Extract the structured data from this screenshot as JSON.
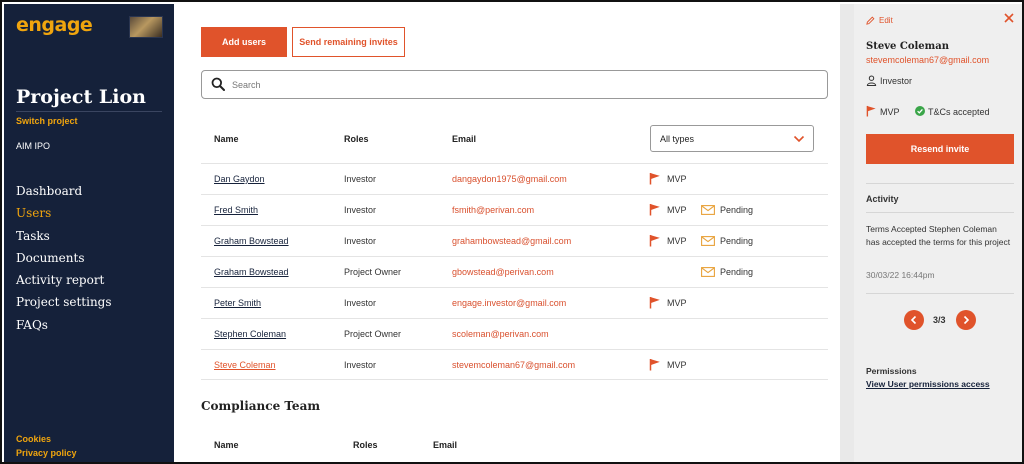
{
  "sidebar": {
    "logo": "engage",
    "project_title": "Project Lion",
    "switch_project": "Switch project",
    "subproject": "AIM IPO",
    "nav": [
      "Dashboard",
      "Users",
      "Tasks",
      "Documents",
      "Activity report",
      "Project settings",
      "FAQs"
    ],
    "active_nav": "Users",
    "cookies": "Cookies",
    "privacy": "Privacy policy"
  },
  "toolbar": {
    "add_users": "Add users",
    "send_invites": "Send remaining invites"
  },
  "search": {
    "placeholder": "Search"
  },
  "table": {
    "headers": {
      "name": "Name",
      "roles": "Roles",
      "email": "Email"
    },
    "type_filter": "All types",
    "mvp_label": "MVP",
    "pending_label": "Pending",
    "rows": [
      {
        "name": "Dan Gaydon",
        "role": "Investor",
        "email": "dangaydon1975@gmail.com",
        "mvp": true,
        "pending": false
      },
      {
        "name": "Fred Smith",
        "role": "Investor",
        "email": "fsmith@perivan.com",
        "mvp": true,
        "pending": true
      },
      {
        "name": "Graham Bowstead",
        "role": "Investor",
        "email": "grahambowstead@gmail.com",
        "mvp": true,
        "pending": true
      },
      {
        "name": "Graham Bowstead",
        "role": "Project Owner",
        "email": "gbowstead@perivan.com",
        "mvp": false,
        "pending": true
      },
      {
        "name": "Peter Smith",
        "role": "Investor",
        "email": "engage.investor@gmail.com",
        "mvp": true,
        "pending": false
      },
      {
        "name": "Stephen Coleman",
        "role": "Project Owner",
        "email": "scoleman@perivan.com",
        "mvp": false,
        "pending": false
      },
      {
        "name": "Steve Coleman",
        "role": "Investor",
        "email": "stevemcoleman67@gmail.com",
        "mvp": true,
        "pending": false,
        "selected": true
      }
    ]
  },
  "compliance": {
    "title": "Compliance Team",
    "headers": {
      "name": "Name",
      "roles": "Roles",
      "email": "Email"
    }
  },
  "panel": {
    "edit": "Edit",
    "name": "Steve Coleman",
    "email": "stevemcoleman67@gmail.com",
    "role": "Investor",
    "mvp": "MVP",
    "tcs": "T&Cs accepted",
    "resend": "Resend invite",
    "activity_title": "Activity",
    "activity_text": "Terms Accepted Stephen Coleman has accepted the terms for this project",
    "activity_time": "30/03/22 16:44pm",
    "pagination": "3/3",
    "permissions_title": "Permissions",
    "permissions_link": "View User permissions access"
  },
  "colors": {
    "accent": "#e0532b",
    "sidebar_bg": "#15213a",
    "brand_gold": "#f0a50e"
  }
}
